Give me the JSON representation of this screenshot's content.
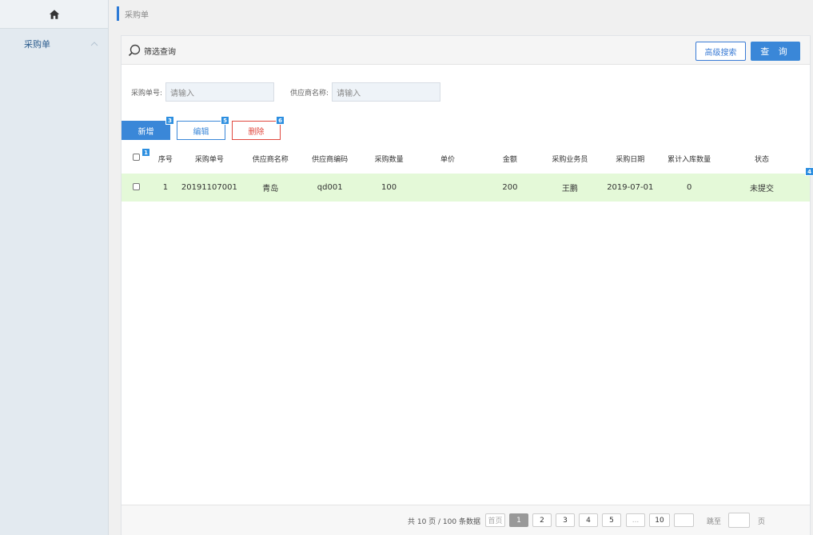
{
  "sidebar": {
    "home_icon": "home-icon",
    "items": [
      {
        "label": "采购单",
        "icon": "chevron-up-icon"
      }
    ]
  },
  "breadcrumb": {
    "label": "采购单"
  },
  "filter": {
    "title": "筛选查询",
    "search_icon": "search-icon",
    "advanced_label": "高级搜索",
    "query_label": "查 询",
    "fields": [
      {
        "label": "采购单号:",
        "placeholder": "请输入"
      },
      {
        "label": "供应商名称:",
        "placeholder": "请输入"
      }
    ]
  },
  "toolbar": {
    "add_label": "新增",
    "edit_label": "编辑",
    "delete_label": "删除"
  },
  "badges": {
    "b1": "1",
    "b3": "3",
    "b4": "4",
    "b5": "5",
    "b6": "6"
  },
  "table": {
    "columns": [
      "序号",
      "采购单号",
      "供应商名称",
      "供应商编码",
      "采购数量",
      "单价",
      "金额",
      "采购业务员",
      "采购日期",
      "累计入库数量",
      "状态"
    ],
    "rows": [
      [
        "1",
        "20191107001",
        "青岛",
        "qd001",
        "100",
        "",
        "200",
        "王鹏",
        "2019-07-01",
        "0",
        "未提交"
      ]
    ]
  },
  "pagination": {
    "info": "共 10 页 / 100 条数据",
    "first": "首页",
    "pages": [
      "1",
      "2",
      "3",
      "4",
      "5",
      "...",
      "10"
    ],
    "active": "1",
    "jump_label": "跳至",
    "page_unit": "页"
  },
  "colors": {
    "accent": "#3a87d8",
    "danger": "#e0483e",
    "row_highlight": "#e4f9d8",
    "sidebar_bg": "#e3eaf0"
  }
}
